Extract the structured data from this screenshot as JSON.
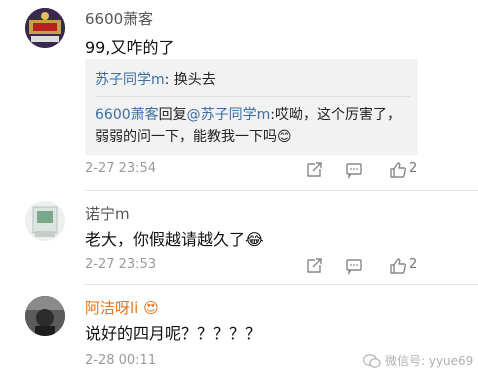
{
  "comments": [
    {
      "username": "6600萧客",
      "content": "99,又咋的了",
      "quote": {
        "first_user": "苏子同学m",
        "first_text": ": 换头去",
        "reply_user": "6600萧客",
        "reply_verb": "回复",
        "reply_target": "@苏子同学m",
        "reply_text": ":哎呦，这个厉害了，弱弱的问一下，能教我一下吗",
        "emoji": "😊"
      },
      "time": "2-27 23:54",
      "likes": "2"
    },
    {
      "username": "诺宁m",
      "content": "老大，你假越请越久了",
      "emoji": "😂",
      "time": "2-27 23:53",
      "likes": "2"
    },
    {
      "username": "阿洁呀li",
      "username_emoji": "😍",
      "content": "说好的四月呢？？？？？",
      "time": "2-28 00:11"
    }
  ],
  "watermark": {
    "text": "微信号: yyue69"
  },
  "colors": {
    "link": "#3a6ea5",
    "orange_name": "#e8731a",
    "meta": "#9a9a9a"
  }
}
